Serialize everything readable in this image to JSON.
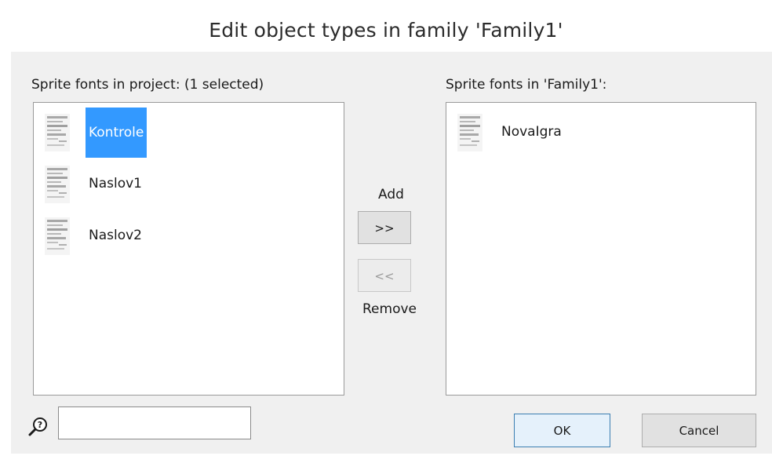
{
  "window": {
    "title": "Edit object types in family 'Family1'"
  },
  "left_panel": {
    "heading": "Sprite fonts in project: (1 selected)",
    "items": [
      {
        "label": "Kontrole",
        "selected": true
      },
      {
        "label": "Naslov1",
        "selected": false
      },
      {
        "label": "Naslov2",
        "selected": false
      }
    ]
  },
  "right_panel": {
    "heading": "Sprite fonts in 'Family1':",
    "items": [
      {
        "label": "NovaIgra",
        "selected": false
      }
    ]
  },
  "transfer": {
    "add_label": "Add",
    "add_button": ">>",
    "remove_button": "<<",
    "remove_label": "Remove"
  },
  "search": {
    "value": "",
    "placeholder": "",
    "icon": "help-search-icon"
  },
  "buttons": {
    "ok": "OK",
    "cancel": "Cancel"
  },
  "colors": {
    "selection": "#3399ff",
    "panel_background": "#f0f0f0",
    "list_background": "#ffffff"
  }
}
